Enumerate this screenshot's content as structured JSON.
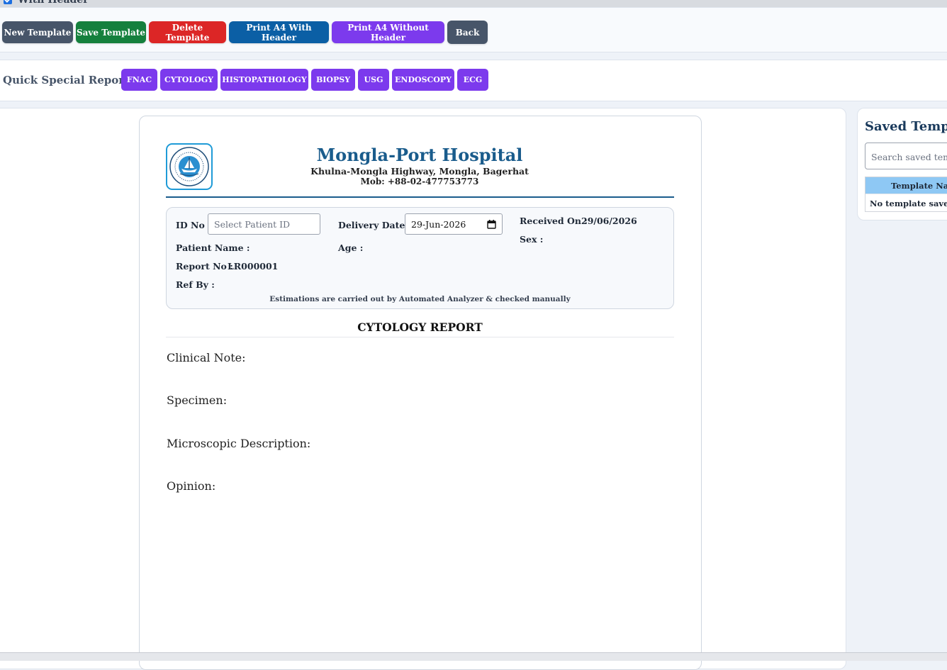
{
  "header_toggle": {
    "label": "With Header",
    "checked": true
  },
  "toolbar": {
    "buttons": [
      {
        "label": "New Template",
        "color": "#475569"
      },
      {
        "label": "Save Template",
        "color": "#15803d"
      },
      {
        "label": "Delete Template",
        "color": "#dc2626"
      },
      {
        "label": "Print A4 With Header",
        "color": "#0b5fa5"
      },
      {
        "label": "Print A4 Without Header",
        "color": "#7c3aed"
      },
      {
        "label": "Back",
        "color": "#475569"
      }
    ]
  },
  "quick_reports": {
    "label": "Quick Special Reports:",
    "buttons": [
      "FNAC",
      "CYTOLOGY",
      "HISTOPATHOLOGY",
      "BIOPSY",
      "USG",
      "ENDOSCOPY",
      "ECG"
    ]
  },
  "report": {
    "hospital_name": "Mongla-Port Hospital",
    "address": "Khulna-Mongla Highway, Mongla, Bagerhat",
    "mobile": "Mob: +88-02-477753773",
    "fields": {
      "id_label": "ID No :",
      "id_placeholder": "Select Patient ID",
      "delivery_label": "Delivery Date :",
      "delivery_value": "29-Jun-2026",
      "received_label": "Received On :",
      "received_value": "29/06/2026",
      "patient_label": "Patient Name :",
      "age_label": "Age :",
      "sex_label": "Sex :",
      "report_no_label": "Report No :",
      "report_no_value": "LR000001",
      "ref_label": "Ref By :"
    },
    "note": "Estimations are carried out by Automated Analyzer & checked manually",
    "title": "CYTOLOGY REPORT",
    "sections": [
      "Clinical Note:",
      "Specimen:",
      "Microscopic Description:",
      "Opinion:"
    ]
  },
  "sidebar": {
    "title": "Saved Templates",
    "search_placeholder": "Search saved templates",
    "column_header": "Template Name",
    "empty_text": "No template saved yet"
  }
}
